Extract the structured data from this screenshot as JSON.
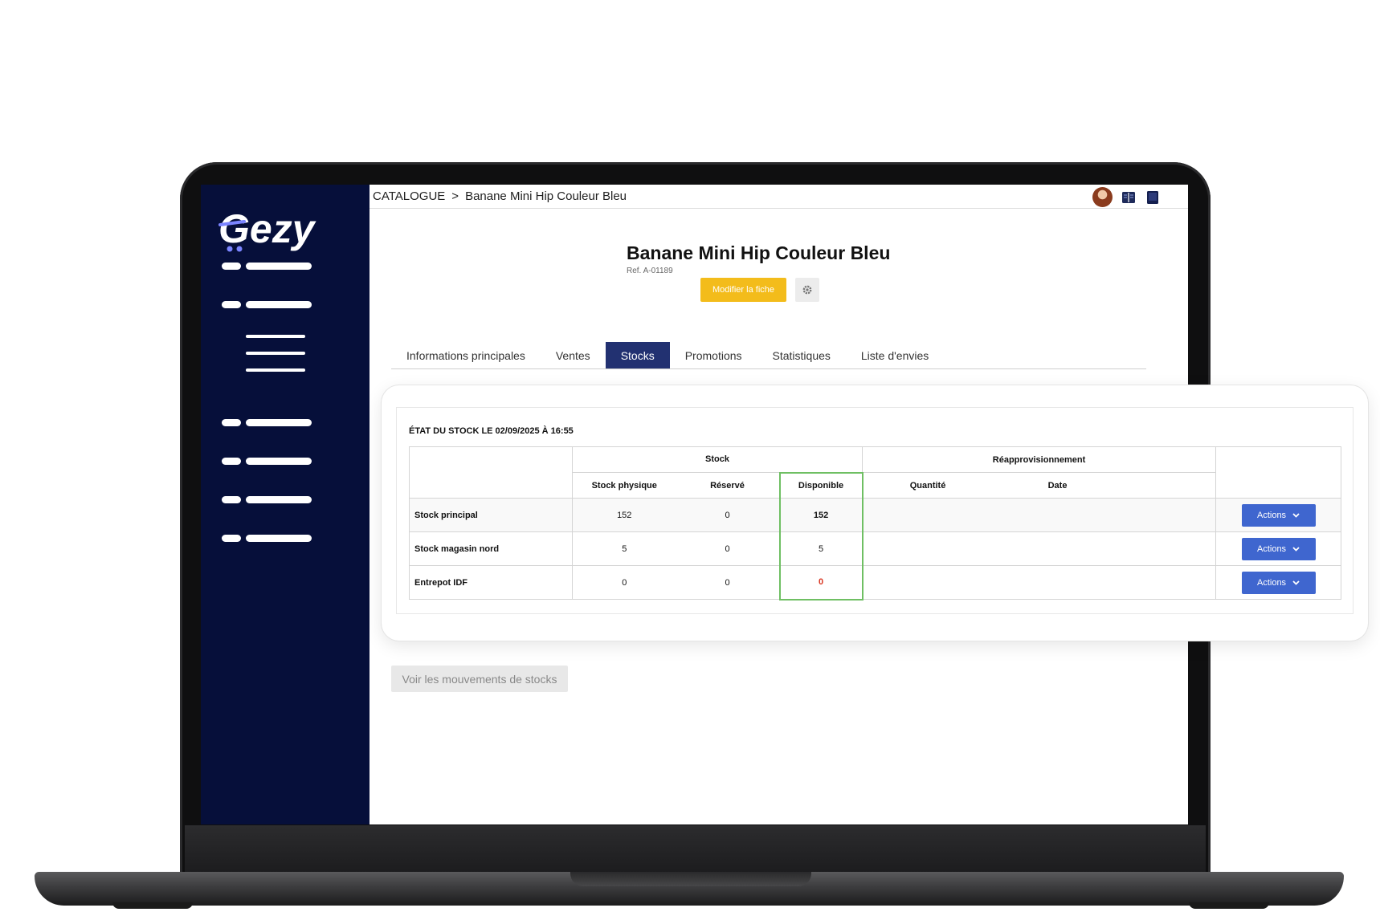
{
  "breadcrumb": {
    "root": "CATALOGUE",
    "separator": ">",
    "current": "Banane Mini Hip Couleur Bleu"
  },
  "product": {
    "title": "Banane Mini Hip Couleur Bleu",
    "ref": "Ref. A-01189",
    "edit_label": "Modifier la fiche"
  },
  "tabs": [
    {
      "label": "Informations principales"
    },
    {
      "label": "Ventes"
    },
    {
      "label": "Stocks"
    },
    {
      "label": "Promotions"
    },
    {
      "label": "Statistiques"
    },
    {
      "label": "Liste d'envies"
    }
  ],
  "active_tab": "Stocks",
  "stock_card": {
    "heading": "ÉTAT DU STOCK LE 02/09/2025 À 16:55",
    "group_stock": "Stock",
    "group_reappro": "Réapprovisionnement",
    "col_physique": "Stock physique",
    "col_reserve": "Réservé",
    "col_disponible": "Disponible",
    "col_quantite": "Quantité",
    "col_date": "Date",
    "rows": [
      {
        "name": "Stock principal",
        "physique": "152",
        "reserve": "0",
        "disponible": "152",
        "quantite": "",
        "date": "",
        "action": "Actions"
      },
      {
        "name": "Stock magasin nord",
        "physique": "5",
        "reserve": "0",
        "disponible": "5",
        "quantite": "",
        "date": "",
        "action": "Actions"
      },
      {
        "name": "Entrepot IDF",
        "physique": "0",
        "reserve": "0",
        "disponible": "0",
        "quantite": "",
        "date": "",
        "action": "Actions"
      }
    ]
  },
  "moves_button": "Voir les mouvements de stocks",
  "logo": "Gezy",
  "colors": {
    "sidebar": "#060f3a",
    "accent_yellow": "#f3bc1b",
    "tab_active": "#223171",
    "actions_blue": "#3f66cf",
    "disponible_border": "#6fbf63",
    "zero_red": "#d9341f"
  }
}
